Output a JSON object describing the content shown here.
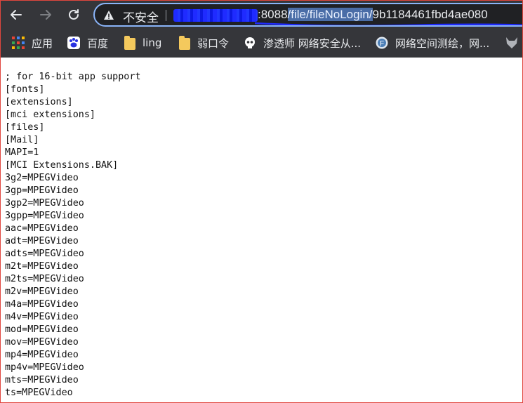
{
  "browser": {
    "security_label": "不安全",
    "url_port": ":8088",
    "url_path_highlighted": "/file/fileNoLogin/",
    "url_tail": "9b1184461fbd4ae080",
    "colors": {
      "toolbar": "#35363a",
      "omnibox_border": "#8ab4f8",
      "redaction": "#1f2bff"
    }
  },
  "bookmarks": [
    {
      "label": "应用",
      "icon": "apps-grid-icon"
    },
    {
      "label": "百度",
      "icon": "baidu-paw-icon"
    },
    {
      "label": "ling",
      "icon": "folder-icon"
    },
    {
      "label": "弱口令",
      "icon": "folder-icon"
    },
    {
      "label": "渗透师 网络安全从...",
      "icon": "skull-icon"
    },
    {
      "label": "网络空间测绘，网...",
      "icon": "fofa-icon"
    }
  ],
  "file_lines": [
    "; for 16-bit app support",
    "[fonts]",
    "[extensions]",
    "[mci extensions]",
    "[files]",
    "[Mail]",
    "MAPI=1",
    "[MCI Extensions.BAK]",
    "3g2=MPEGVideo",
    "3gp=MPEGVideo",
    "3gp2=MPEGVideo",
    "3gpp=MPEGVideo",
    "aac=MPEGVideo",
    "adt=MPEGVideo",
    "adts=MPEGVideo",
    "m2t=MPEGVideo",
    "m2ts=MPEGVideo",
    "m2v=MPEGVideo",
    "m4a=MPEGVideo",
    "m4v=MPEGVideo",
    "mod=MPEGVideo",
    "mov=MPEGVideo",
    "mp4=MPEGVideo",
    "mp4v=MPEGVideo",
    "mts=MPEGVideo",
    "ts=MPEGVideo"
  ]
}
